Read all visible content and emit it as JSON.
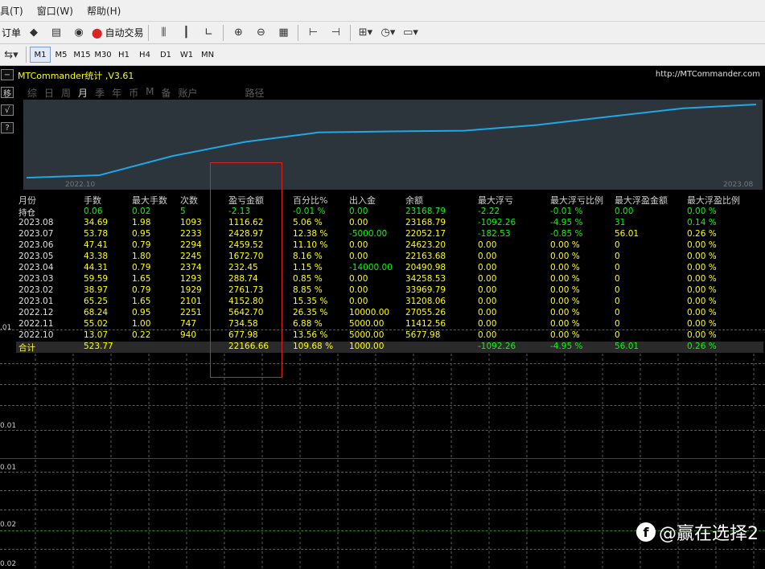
{
  "menu": [
    "具(T)",
    "窗口(W)",
    "帮助(H)"
  ],
  "toolbar1": {
    "neworder_label": "订单",
    "autotrade_label": "自动交易"
  },
  "timeframes": [
    "M1",
    "M5",
    "M15",
    "M30",
    "H1",
    "H4",
    "D1",
    "W1",
    "MN"
  ],
  "panel": {
    "title": "MTCommander统计 ,V3.61",
    "url": "http://MTCommander.com",
    "tabs": [
      "综",
      "日",
      "周",
      "月",
      "季",
      "年",
      "币",
      "M",
      "备",
      "账户",
      "路径"
    ],
    "active_tab": "月",
    "chart_x_start": "2022.10",
    "chart_x_end": "2023.08",
    "line_color": "#1fa8e8"
  },
  "chart_data": {
    "type": "line",
    "x": [
      "2022.10",
      "2022.11",
      "2022.12",
      "2023.01",
      "2023.02",
      "2023.03",
      "2023.04",
      "2023.05",
      "2023.06",
      "2023.07",
      "2023.08"
    ],
    "y": [
      677.98,
      1412.56,
      7055.26,
      11208.06,
      13969.79,
      14258.53,
      14490.98,
      16163.68,
      18623.2,
      21052.17,
      22168.79
    ]
  },
  "table": {
    "headers": [
      "月份",
      "手数",
      "最大手数",
      "次数",
      "盈亏金额",
      "百分比%",
      "出入金",
      "余额",
      "最大浮亏",
      "最大浮亏比例",
      "最大浮盈金额",
      "最大浮盈比例"
    ],
    "holding": [
      "持仓",
      "0.06",
      "0.02",
      "5",
      "-2.13",
      "-0.01 %",
      "0.00",
      "23168.79",
      "-2.22",
      "-0.01 %",
      "0.00",
      "0.00 %"
    ],
    "rows": [
      [
        "2023.08",
        "34.69",
        "1.98",
        "1093",
        "1116.62",
        "5.06 %",
        "0.00",
        "23168.79",
        "-1092.26",
        "-4.95 %",
        "31",
        "0.14 %"
      ],
      [
        "2023.07",
        "53.78",
        "0.95",
        "2233",
        "2428.97",
        "12.38 %",
        "-5000.00",
        "22052.17",
        "-182.53",
        "-0.85 %",
        "56.01",
        "0.26 %"
      ],
      [
        "2023.06",
        "47.41",
        "0.79",
        "2294",
        "2459.52",
        "11.10 %",
        "0.00",
        "24623.20",
        "0.00",
        "0.00 %",
        "0",
        "0.00 %"
      ],
      [
        "2023.05",
        "43.38",
        "1.80",
        "2245",
        "1672.70",
        "8.16 %",
        "0.00",
        "22163.68",
        "0.00",
        "0.00 %",
        "0",
        "0.00 %"
      ],
      [
        "2023.04",
        "44.31",
        "0.79",
        "2374",
        "232.45",
        "1.15 %",
        "-14000.00",
        "20490.98",
        "0.00",
        "0.00 %",
        "0",
        "0.00 %"
      ],
      [
        "2023.03",
        "59.59",
        "1.65",
        "1293",
        "288.74",
        "0.85 %",
        "0.00",
        "34258.53",
        "0.00",
        "0.00 %",
        "0",
        "0.00 %"
      ],
      [
        "2023.02",
        "38.97",
        "0.79",
        "1929",
        "2761.73",
        "8.85 %",
        "0.00",
        "33969.79",
        "0.00",
        "0.00 %",
        "0",
        "0.00 %"
      ],
      [
        "2023.01",
        "65.25",
        "1.65",
        "2101",
        "4152.80",
        "15.35 %",
        "0.00",
        "31208.06",
        "0.00",
        "0.00 %",
        "0",
        "0.00 %"
      ],
      [
        "2022.12",
        "68.24",
        "0.95",
        "2251",
        "5642.70",
        "26.35 %",
        "10000.00",
        "27055.26",
        "0.00",
        "0.00 %",
        "0",
        "0.00 %"
      ],
      [
        "2022.11",
        "55.02",
        "1.00",
        "747",
        "734.58",
        "6.88 %",
        "5000.00",
        "11412.56",
        "0.00",
        "0.00 %",
        "0",
        "0.00 %"
      ],
      [
        "2022.10",
        "13.07",
        "0.22",
        "940",
        "677.98",
        "13.56 %",
        "5000.00",
        "5677.98",
        "0.00",
        "0.00 %",
        "0",
        "0.00 %"
      ]
    ],
    "total": [
      "合计",
      "523.77",
      "",
      "",
      "22166.66",
      "109.68 %",
      "1000.00",
      "",
      "-1092.26",
      "-4.95 %",
      "56.01",
      "0.26 %"
    ]
  },
  "price_axis": [
    ".01",
    "0.01",
    "0.01",
    "0.02",
    "0.02"
  ],
  "watermark": "@赢在选择2"
}
